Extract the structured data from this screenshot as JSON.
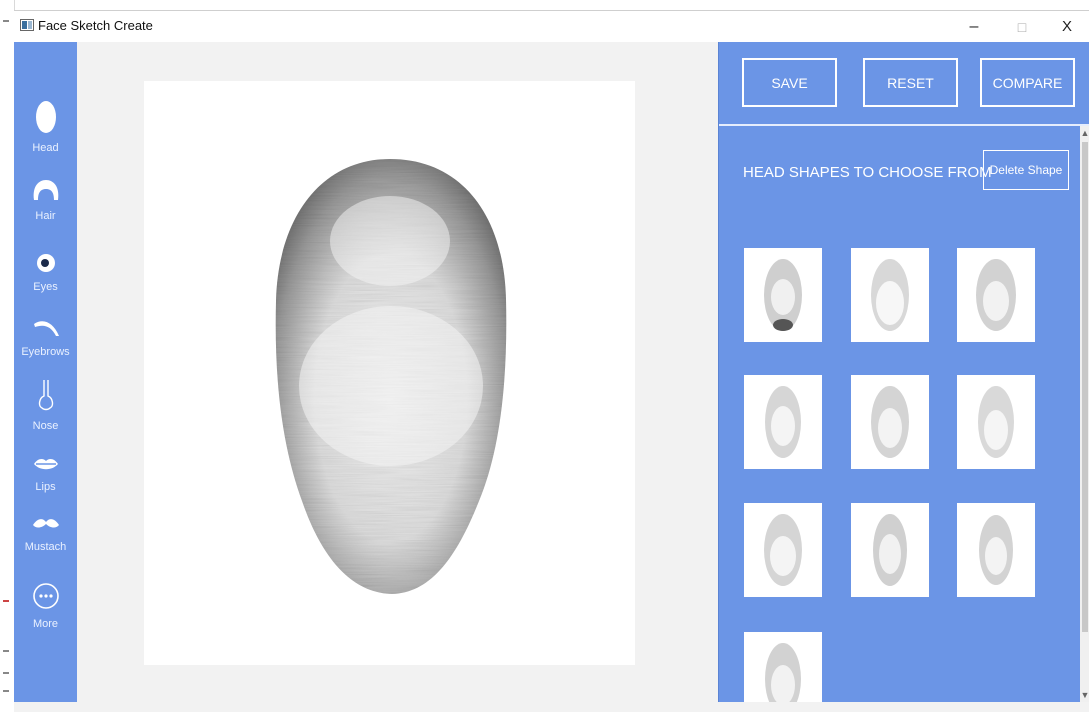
{
  "window": {
    "title": "Face Sketch Create",
    "minimize": "–",
    "maximize": "□",
    "close": "X"
  },
  "sidebar": {
    "items": [
      {
        "label": "Head",
        "icon": "head-icon"
      },
      {
        "label": "Hair",
        "icon": "hair-icon"
      },
      {
        "label": "Eyes",
        "icon": "eye-icon"
      },
      {
        "label": "Eyebrows",
        "icon": "eyebrow-icon"
      },
      {
        "label": "Nose",
        "icon": "nose-icon"
      },
      {
        "label": "Lips",
        "icon": "lips-icon"
      },
      {
        "label": "Mustach",
        "icon": "mustache-icon"
      },
      {
        "label": "More",
        "icon": "more-icon"
      }
    ]
  },
  "toolbar": {
    "save_label": "SAVE",
    "reset_label": "RESET",
    "compare_label": "COMPARE"
  },
  "shapes_panel": {
    "heading": "HEAD SHAPES TO CHOOSE FROM",
    "delete_label": "Delete Shape",
    "thumbnail_count": 10
  },
  "colors": {
    "accent": "#6b95e6",
    "background": "#f2f2f2",
    "text_on_accent": "#ffffff"
  }
}
